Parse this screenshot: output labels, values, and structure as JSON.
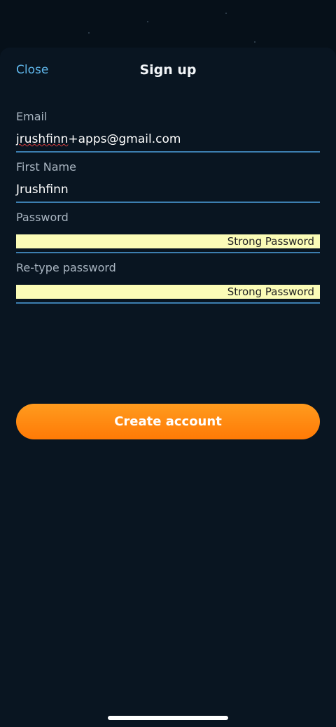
{
  "header": {
    "close_label": "Close",
    "title": "Sign up"
  },
  "form": {
    "email": {
      "label": "Email",
      "value_misspelled_part": "jrushfinn",
      "value_rest": "+apps@gmail.com"
    },
    "first_name": {
      "label": "First Name",
      "value": "Jrushfinn"
    },
    "password": {
      "label": "Password",
      "autofill_text": "Strong Password"
    },
    "retype_password": {
      "label": "Re-type password",
      "autofill_text": "Strong Password"
    }
  },
  "actions": {
    "create_account_label": "Create account"
  },
  "colors": {
    "background": "#061019",
    "sheet": "#091521",
    "accent_link": "#5fb6ea",
    "field_underline": "#3c7eb0",
    "autofill_bg": "#fbfcb7",
    "cta_orange": "#ff8a10"
  }
}
